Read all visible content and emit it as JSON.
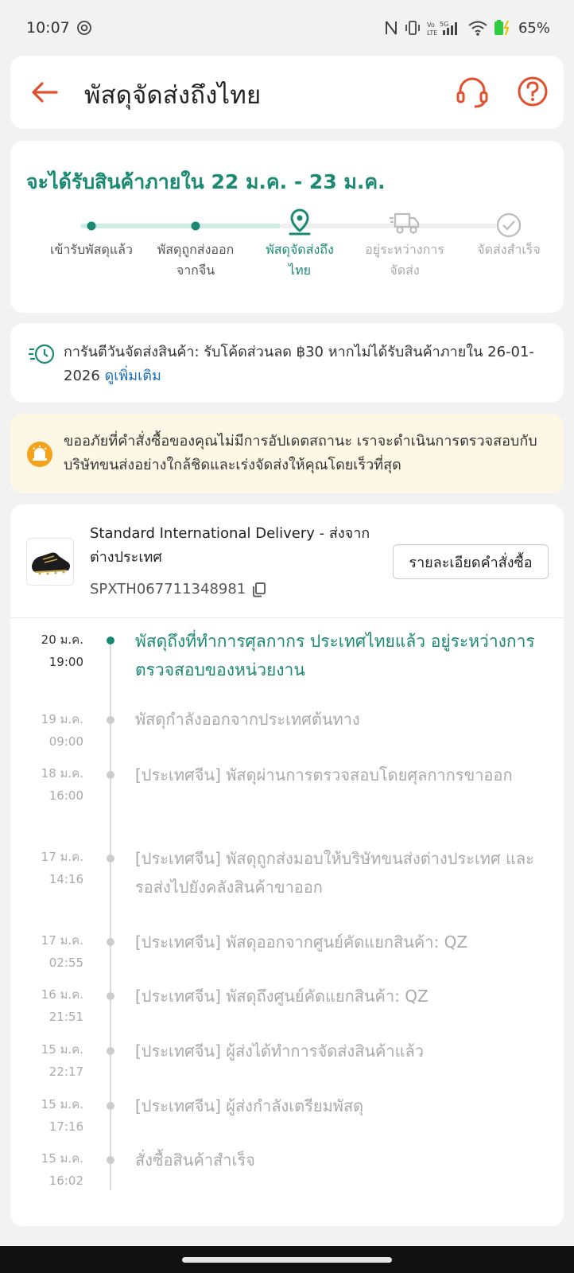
{
  "status_bar": {
    "time": "10:07",
    "battery": "65%",
    "network_label": "5G"
  },
  "header": {
    "title": "พัสดุจัดส่งถึงไทย"
  },
  "delivery": {
    "estimate": "จะได้รับสินค้าภายใน 22 ม.ค. - 23 ม.ค.",
    "steps": [
      {
        "line1": "เข้ารับพัสดุแล้ว",
        "line2": ""
      },
      {
        "line1": "พัสดุถูกส่งออก",
        "line2": "จากจีน"
      },
      {
        "line1": "พัสดุจัดส่งถึง",
        "line2": "ไทย"
      },
      {
        "line1": "อยู่ระหว่างการ",
        "line2": "จัดส่ง"
      },
      {
        "line1": "จัดส่งสำเร็จ",
        "line2": ""
      }
    ]
  },
  "guarantee": {
    "text": "การันตีวันจัดส่งสินค้า: รับโค้ดส่วนลด ฿30 หากไม่ได้รับสินค้าภายใน 26-01-2026",
    "link": "ดูเพิ่มเติม"
  },
  "notice": {
    "text": "ขออภัยที่คำสั่งซื้อของคุณไม่มีการอัปเดตสถานะ เราจะดำเนินการตรวจสอบกับบริษัทขนส่งอย่างใกล้ชิดและเร่งจัดส่งให้คุณโดยเร็วที่สุด"
  },
  "order": {
    "carrier": "Standard International Delivery - ส่งจากต่างประเทศ",
    "tracking_number": "SPXTH067711348981",
    "detail_button": "รายละเอียดคำสั่งซื้อ"
  },
  "timeline": [
    {
      "date": "20 ม.ค.",
      "time": "19:00",
      "text": "พัสดุถึงที่ทำการศุลกากร ประเทศไทยแล้ว อยู่ระหว่างการตรวจสอบของหน่วยงาน"
    },
    {
      "date": "19 ม.ค.",
      "time": "09:00",
      "text": "พัสดุกำลังออกจากประเทศต้นทาง"
    },
    {
      "date": "18 ม.ค.",
      "time": "16:00",
      "text": "[ประเทศจีน] พัสดุผ่านการตรวจสอบโดยศุลกากรขาออก"
    },
    {
      "date": "17 ม.ค.",
      "time": "14:16",
      "text": "[ประเทศจีน] พัสดุถูกส่งมอบให้บริษัทขนส่งต่างประเทศ และรอส่งไปยังคลังสินค้าขาออก"
    },
    {
      "date": "17 ม.ค.",
      "time": "02:55",
      "text": "[ประเทศจีน] พัสดุออกจากศูนย์คัดแยกสินค้า: QZ"
    },
    {
      "date": "16 ม.ค.",
      "time": "21:51",
      "text": "[ประเทศจีน] พัสดุถึงศูนย์คัดแยกสินค้า: QZ"
    },
    {
      "date": "15 ม.ค.",
      "time": "22:17",
      "text": "[ประเทศจีน] ผู้ส่งได้ทำการจัดส่งสินค้าแล้ว"
    },
    {
      "date": "15 ม.ค.",
      "time": "17:16",
      "text": "[ประเทศจีน] ผู้ส่งกำลังเตรียมพัสดุ"
    },
    {
      "date": "15 ม.ค.",
      "time": "16:02",
      "text": "สั่งซื้อสินค้าสำเร็จ"
    }
  ],
  "colors": {
    "accent_green": "#1a8a73",
    "accent_orange": "#e0502e",
    "link_blue": "#1a6fb5",
    "notice_bg": "#fdf8e6"
  }
}
